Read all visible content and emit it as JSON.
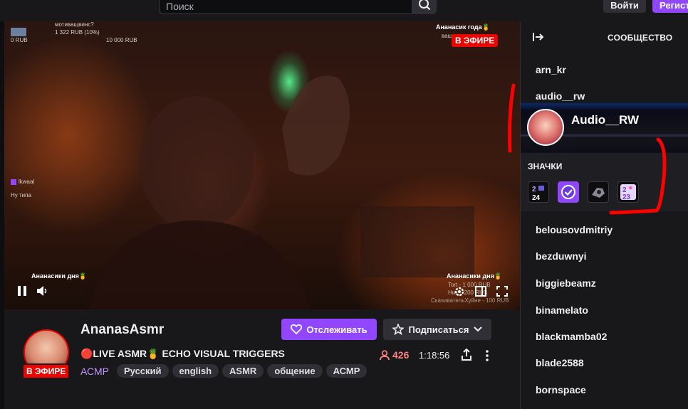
{
  "topbar": {
    "search_placeholder": "Поиск",
    "login_label": "Войти",
    "register_label": "Регист"
  },
  "video": {
    "overlay_top_left": {
      "money_left": "0 RUB",
      "goal_label": "мотиващвинс?",
      "goal_amount": "1 322 RUB (10%)",
      "goal_target": "10 000 RUB"
    },
    "overlay_top_right": "Ананасик года🍍",
    "overlay_top_right_sub": "ваш...",
    "live_label": "В ЭФИРЕ",
    "chat_user": "lkwaal",
    "chat_message": "Ну типа",
    "overlay_bottom_left": "Ананасики дня🍍",
    "overlay_bottom_right": "Ананасики дня🍍",
    "overlay_bottom_right_l1": "Tort - 1 000 RUB",
    "overlay_bottom_right_l2": "Ник... 200 RUB",
    "overlay_bottom_right_l3": "СкачивательХуйне - 100 RUB"
  },
  "channel": {
    "name": "AnanasAsmr",
    "live_label": "В ЭФИРЕ",
    "title": "🔴LIVE ASMR🍍 ECHO VISUAL TRIGGERS",
    "category": "АСМР",
    "tags": [
      "Русский",
      "english",
      "ASMR",
      "общение",
      "АСМР"
    ],
    "follow_label": "Отслеживать",
    "subscribe_label": "Подписаться",
    "viewers": "426",
    "uptime": "1:18:56"
  },
  "sidebar": {
    "title": "СООБЩЕСТВО",
    "users_top": [
      "arn_kr",
      "audio__rw"
    ],
    "card": {
      "display_name": "Audio__RW",
      "badges_title": "ЗНАЧКИ",
      "badges": [
        "2024-badge-icon",
        "verified-badge-icon",
        "game-badge-icon",
        "2023-badge-icon"
      ]
    },
    "users": [
      "belousovdmitriy",
      "bezduwnyi",
      "biggiebeamz",
      "binamelato",
      "blackmamba02",
      "blade2588",
      "bornspace"
    ]
  },
  "colors": {
    "accent": "#9147ff",
    "live": "#eb0400",
    "annotation": "#ff0000"
  }
}
